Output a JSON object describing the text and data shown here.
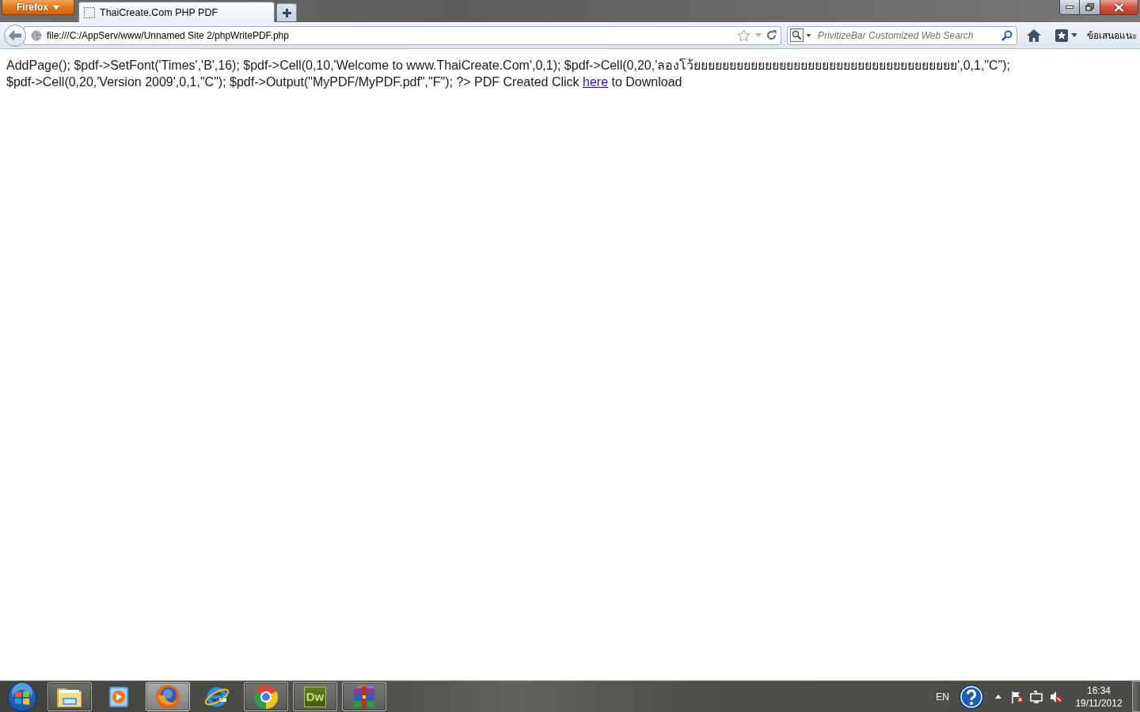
{
  "browser_button": {
    "label": "Firefox"
  },
  "tabs": [
    {
      "title": "ThaiCreate.Com PHP PDF",
      "selected": true
    }
  ],
  "navigation": {
    "address": "file:///C:/AppServ/www/Unnamed Site 2/phpWritePDF.php",
    "search": {
      "placeholder": "PrivitizeBar Customized Web Search"
    },
    "toolbar_label": "ข้อเสนอแนะ"
  },
  "page": {
    "text": "AddPage(); $pdf->SetFont('Times','B',16); $pdf->Cell(0,10,'Welcome to www.ThaiCreate.Com',0,1); $pdf->Cell(0,20,'ลองโว้ยยยยยยยยยยยยยยยยยยยยยยยยยยยยยยยยยยยยย',0,1,\"C\"); $pdf->Cell(0,20,'Version 2009',0,1,\"C\"); $pdf->Output(\"MyPDF/MyPDF.pdf\",\"F\"); ?> PDF Created Click",
    "link": "here",
    "text_after": "to Download"
  },
  "taskbar": {
    "items": [
      {
        "kind": "folder",
        "running": true,
        "selected": false
      },
      {
        "kind": "player",
        "running": false,
        "selected": false
      },
      {
        "kind": "firefox",
        "running": true,
        "selected": true
      },
      {
        "kind": "explorer",
        "running": false,
        "selected": false
      },
      {
        "kind": "chrome",
        "running": true,
        "selected": false
      },
      {
        "kind": "dreamweaver",
        "label": "Dw",
        "running": true,
        "selected": false
      },
      {
        "kind": "archiver",
        "running": true,
        "selected": false
      }
    ],
    "tray": {
      "language": "EN",
      "time": "16:34",
      "date": "19/11/2012"
    }
  }
}
